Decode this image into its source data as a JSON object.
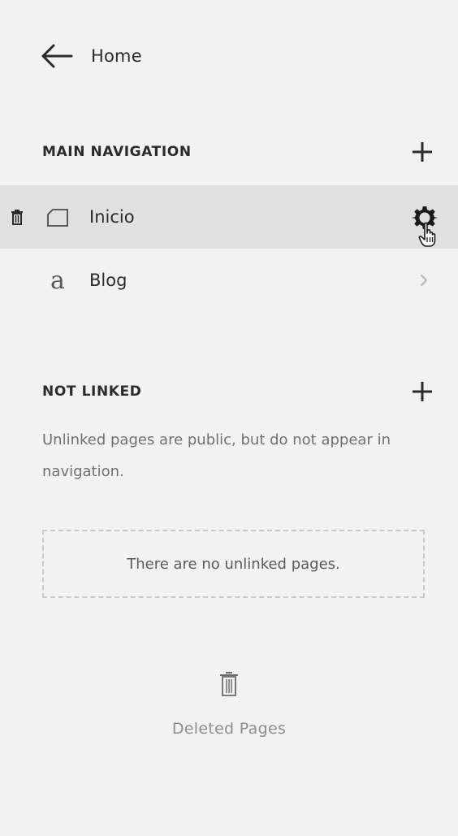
{
  "back": {
    "label": "Home",
    "icon": "arrow-left-icon"
  },
  "main_navigation": {
    "title": "MAIN NAVIGATION",
    "add_icon": "plus-icon",
    "items": [
      {
        "label": "Inicio",
        "icon": "page-icon",
        "action_icon": "gear-icon",
        "delete_icon": "trash-icon",
        "selected": true
      },
      {
        "label": "Blog",
        "icon": "a",
        "action_icon": "chevron-right-icon",
        "selected": false
      }
    ]
  },
  "not_linked": {
    "title": "NOT LINKED",
    "add_icon": "plus-icon",
    "description": "Unlinked pages are public, but do not appear in navigation.",
    "empty_message": "There are no unlinked pages."
  },
  "deleted_pages": {
    "label": "Deleted Pages",
    "icon": "trash-icon"
  },
  "colors": {
    "background": "#f2f2f2",
    "active_row": "#e0e0e0",
    "text": "#2b2b2b",
    "muted_text": "#707070",
    "dashed_border": "#c9c9c9"
  }
}
